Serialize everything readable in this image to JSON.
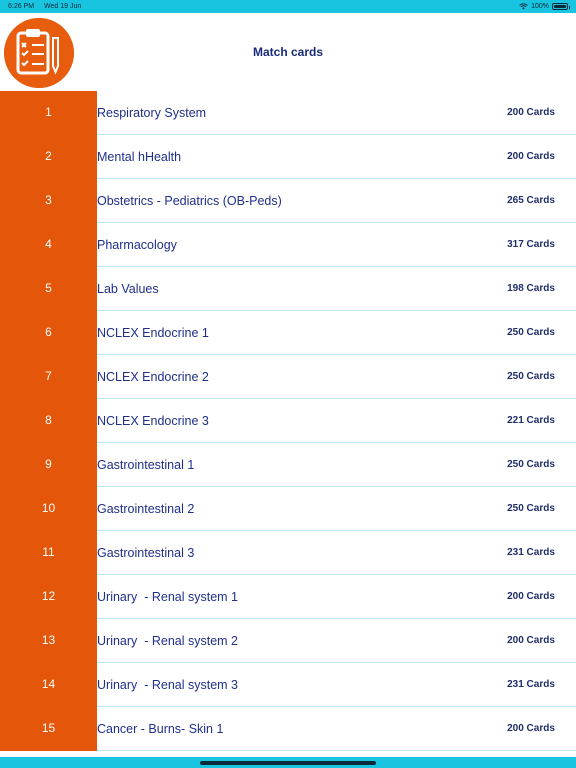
{
  "status_bar": {
    "time": "6:26 PM",
    "date": "Wed 19 Jun",
    "battery": "100%",
    "wifi_icon": "wifi-icon",
    "battery_icon": "battery-icon"
  },
  "header": {
    "title": "Match cards",
    "logo_icon": "clipboard-checklist-icon",
    "logo_color": "#e85c0d"
  },
  "colors": {
    "status_bar": "#18c4df",
    "number_cell": "#e4560a",
    "title_text": "#1f2f8a",
    "row_divider": "#bfe9f2"
  },
  "rows": [
    {
      "number": "1",
      "title": "Respiratory System",
      "count": "200 Cards"
    },
    {
      "number": "2",
      "title": "Mental hHealth",
      "count": "200 Cards"
    },
    {
      "number": "3",
      "title": "Obstetrics - Pediatrics (OB-Peds)",
      "count": "265 Cards"
    },
    {
      "number": "4",
      "title": "Pharmacology",
      "count": "317 Cards"
    },
    {
      "number": "5",
      "title": "Lab Values",
      "count": "198 Cards"
    },
    {
      "number": "6",
      "title": "NCLEX Endocrine 1",
      "count": "250 Cards"
    },
    {
      "number": "7",
      "title": "NCLEX Endocrine 2",
      "count": "250 Cards"
    },
    {
      "number": "8",
      "title": "NCLEX Endocrine 3",
      "count": "221 Cards"
    },
    {
      "number": "9",
      "title": "Gastrointestinal 1",
      "count": "250 Cards"
    },
    {
      "number": "10",
      "title": "Gastrointestinal 2",
      "count": "250 Cards"
    },
    {
      "number": "11",
      "title": "Gastrointestinal 3",
      "count": "231 Cards"
    },
    {
      "number": "12",
      "title": "Urinary  - Renal system 1",
      "count": "200 Cards"
    },
    {
      "number": "13",
      "title": "Urinary  - Renal system 2",
      "count": "200 Cards"
    },
    {
      "number": "14",
      "title": "Urinary  - Renal system 3",
      "count": "231 Cards"
    },
    {
      "number": "15",
      "title": "Cancer - Burns- Skin 1",
      "count": "200 Cards"
    }
  ]
}
